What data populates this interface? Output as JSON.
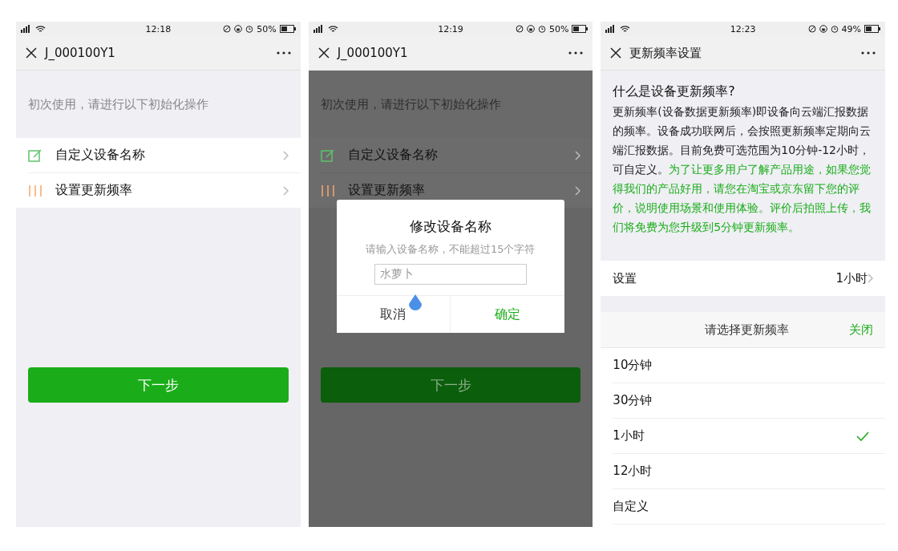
{
  "screens": [
    {
      "kind": "setup",
      "status_bar": {
        "time": "12:18",
        "battery": "50%"
      },
      "nav": {
        "title": "J_000100Y1"
      },
      "intro": "初次使用，请进行以下初始化操作",
      "menu": [
        {
          "kind": "edit",
          "label": "自定义设备名称"
        },
        {
          "kind": "bars",
          "label": "设置更新频率"
        }
      ],
      "next_button": "下一步"
    },
    {
      "kind": "setup",
      "status_bar": {
        "time": "12:19",
        "battery": "50%"
      },
      "nav": {
        "title": "J_000100Y1"
      },
      "intro": "初次使用，请进行以下初始化操作",
      "menu": [
        {
          "kind": "edit",
          "label": "自定义设备名称"
        },
        {
          "kind": "bars",
          "label": "设置更新频率"
        }
      ],
      "next_button": "下一步",
      "dialog": {
        "title": "修改设备名称",
        "hint": "请输入设备名称，不能超过15个字符",
        "value": "水萝卜",
        "cancel": "取消",
        "confirm": "确定"
      }
    },
    {
      "kind": "frequency",
      "status_bar": {
        "time": "12:23",
        "battery": "49%"
      },
      "nav": {
        "title": "更新频率设置"
      },
      "heading": "什么是设备更新频率?",
      "body": [
        {
          "text": "更新频率(设备数据更新频率)即设备向云端汇报数据的频率。设备成功联网后，会按照更新频率定期向云端汇报数据。目前免费可选范围为10分钟-12小时，可自定义。",
          "highlight": false
        },
        {
          "text": "为了让更多用户了解产品用途，如果您觉得我们的产品好用，请您在淘宝或京东留下您的评价，说明使用场景和使用体验。评价后拍照上传，我们将免费为您升级到5分钟更新频率。",
          "highlight": true
        }
      ],
      "setting": {
        "label": "设置",
        "value": "1小时"
      },
      "picker": {
        "title": "请选择更新频率",
        "close": "关闭",
        "options": [
          {
            "label": "10分钟",
            "selected": false
          },
          {
            "label": "30分钟",
            "selected": false
          },
          {
            "label": "1小时",
            "selected": true
          },
          {
            "label": "12小时",
            "selected": false
          },
          {
            "label": "自定义",
            "selected": false
          }
        ]
      }
    }
  ]
}
